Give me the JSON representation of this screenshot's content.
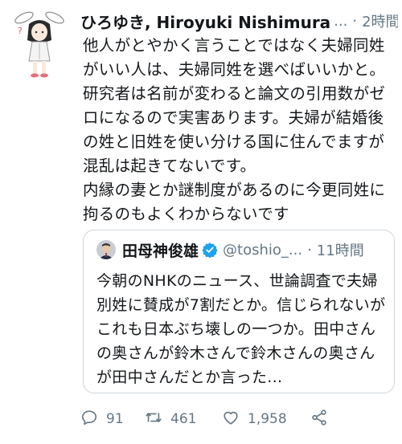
{
  "tweet": {
    "name": "ひろゆき, Hiroyuki Nishimura",
    "handle": "...",
    "time_sep": "·",
    "time": "2時間",
    "text": "他人がとやかく言うことではなく夫婦同姓がいい人は、夫婦同姓を選べばいいかと。\n研究者は名前が変わると論文の引用数がゼロになるので実害あります。夫婦が結婚後の姓と旧姓を使い分ける国に住んでますが混乱は起きてないです。\n内縁の妻とか謎制度があるのに今更同姓に拘るのもよくわからないです"
  },
  "quote": {
    "name": "田母神俊雄",
    "handle": "@toshio_...",
    "time_sep": "·",
    "time": "11時間",
    "text": "今朝のNHKのニュース、世論調査で夫婦別姓に賛成が7割だとか。信じられないがこれも日本ぶち壊しの一つか。田中さんの奥さんが鈴木さんで鈴木さんの奥さんが田中さんだとか言った..."
  },
  "actions": {
    "reply_count": "91",
    "retweet_count": "461",
    "like_count": "1,958"
  },
  "colors": {
    "text": "#14171a",
    "secondary": "#657786",
    "border": "#ccd6dd",
    "verified": "#1da1f2"
  },
  "icons": {
    "reply": "reply-icon",
    "retweet": "retweet-icon",
    "like": "heart-icon",
    "share": "share-icon",
    "verified": "verified-badge-icon"
  }
}
